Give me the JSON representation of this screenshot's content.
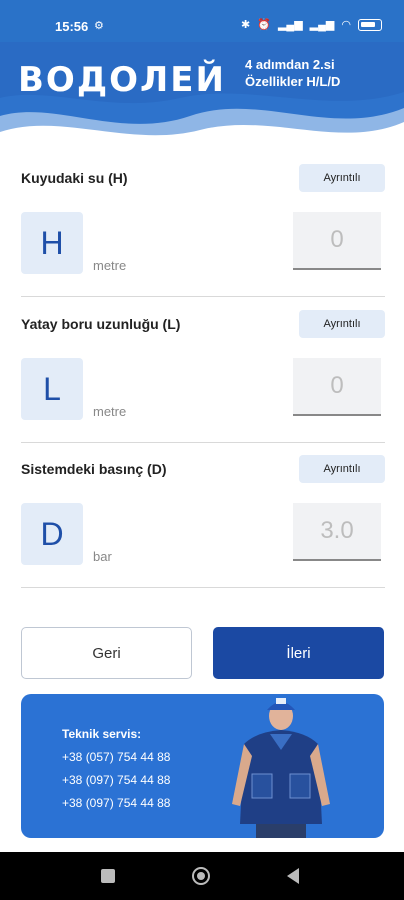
{
  "status_bar": {
    "time": "15:56",
    "gear_icon": "gear-icon",
    "battery": "76"
  },
  "header": {
    "logo": "ВОДОЛЕЙ",
    "step_line1": "4 adımdan 2.si",
    "step_line2": "Özellikler H/L/D"
  },
  "sections": [
    {
      "title": "Kuyudaki su  (H)",
      "details_label": "Ayrıntılı",
      "letter": "H",
      "unit": "metre",
      "value": "0"
    },
    {
      "title": "Yatay boru uzunluğu (L)",
      "details_label": "Ayrıntılı",
      "letter": "L",
      "unit": "metre",
      "value": "0"
    },
    {
      "title": "Sistemdeki basınç (D)",
      "details_label": "Ayrıntılı",
      "letter": "D",
      "unit": "bar",
      "value": "3.0"
    }
  ],
  "buttons": {
    "back": "Geri",
    "next": "İleri"
  },
  "service": {
    "title": "Teknik servis:",
    "phones": [
      "+38 (057) 754 44 88",
      "+38 (097) 754 44 88",
      "+38 (097) 754 44 88"
    ]
  }
}
